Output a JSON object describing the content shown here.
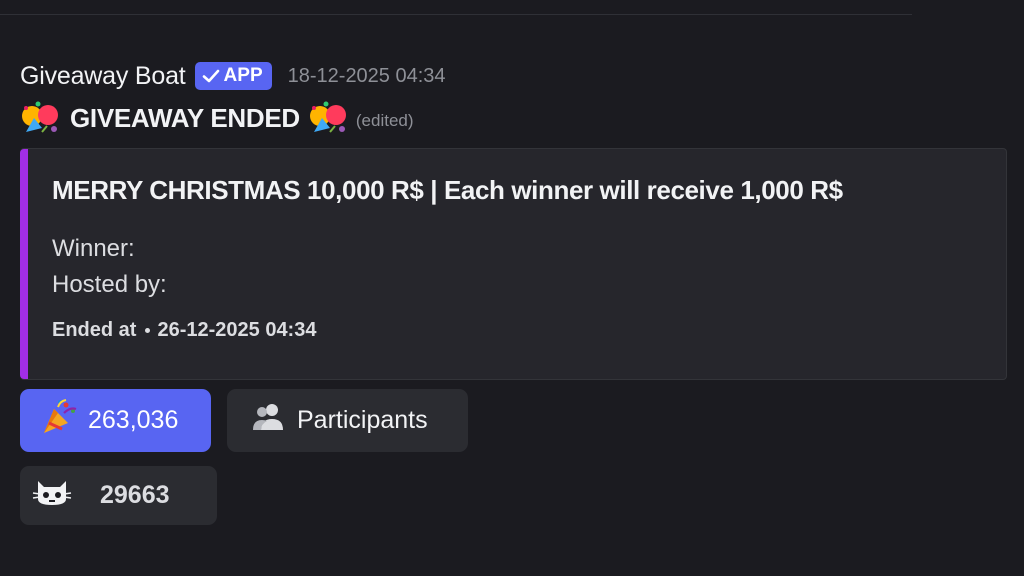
{
  "message": {
    "author": "Giveaway Boat",
    "badge": {
      "label": "APP",
      "icon": "check-icon",
      "color": "#5865f2"
    },
    "timestamp": "18-12-2025 04:34",
    "title": "GIVEAWAY ENDED",
    "title_emoji": "party-popper-icon",
    "edited": "(edited)"
  },
  "embed": {
    "accent_color": "#a12ee6",
    "title": "MERRY CHRISTMAS 10,000 R$ | Each winner will receive 1,000 R$",
    "winner_label": "Winner:",
    "hosted_label": "Hosted by:",
    "ended_label": "Ended at",
    "ended_value": "26-12-2025 04:34"
  },
  "buttons": {
    "enter": {
      "icon": "party-popper-icon",
      "label": "263,036",
      "color": "#5865f2"
    },
    "participants": {
      "icon": "users-icon",
      "label": "Participants"
    },
    "extra": {
      "icon": "cat-icon",
      "label": "29663"
    }
  }
}
